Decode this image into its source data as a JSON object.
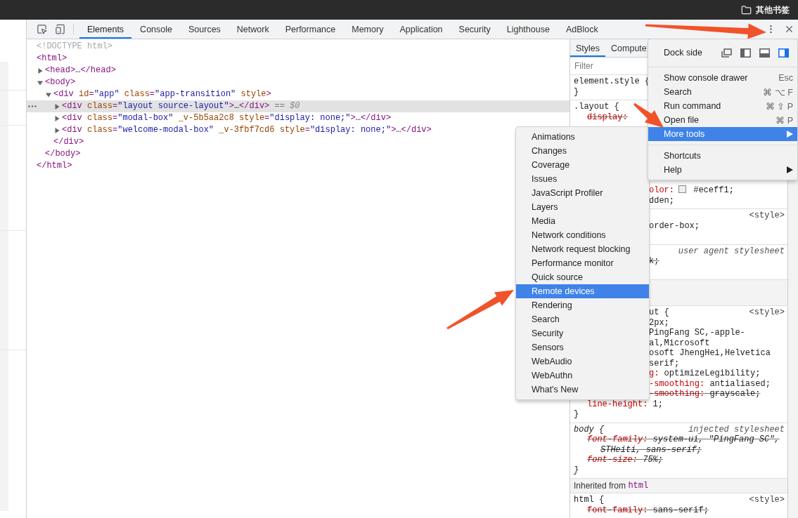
{
  "bookmarks_bar": {
    "folder": "其他书签"
  },
  "toolbar": {
    "tabs": [
      {
        "label": "Elements",
        "selected": true
      },
      {
        "label": "Console",
        "selected": false
      },
      {
        "label": "Sources",
        "selected": false
      },
      {
        "label": "Network",
        "selected": false
      },
      {
        "label": "Performance",
        "selected": false
      },
      {
        "label": "Memory",
        "selected": false
      },
      {
        "label": "Application",
        "selected": false
      },
      {
        "label": "Security",
        "selected": false
      },
      {
        "label": "Lighthouse",
        "selected": false
      },
      {
        "label": "AdBlock",
        "selected": false
      }
    ]
  },
  "dom_tree": [
    {
      "selected": false,
      "tokens": [
        {
          "kind": "doctype",
          "text": "<!DOCTYPE html>"
        }
      ]
    },
    {
      "selected": false,
      "tokens": [
        {
          "kind": "tag",
          "text": "<html>"
        }
      ],
      "closing": [
        {
          "kind": "tag",
          "text": "</html>"
        }
      ],
      "children": [
        {
          "selected": false,
          "expanded": false,
          "tokens": [
            {
              "kind": "tag",
              "text": "<head>"
            },
            {
              "kind": "text",
              "text": "…"
            },
            {
              "kind": "tag",
              "text": "</head>"
            }
          ]
        },
        {
          "selected": false,
          "expanded": true,
          "tokens": [
            {
              "kind": "tag",
              "text": "<body>"
            }
          ],
          "closing": [
            {
              "kind": "tag",
              "text": "</body>"
            }
          ],
          "children": [
            {
              "selected": false,
              "expanded": true,
              "tokens": [
                {
                  "kind": "tag",
                  "text": "<div"
                },
                {
                  "kind": "attr",
                  "text": " id"
                },
                {
                  "kind": "tag",
                  "text": "="
                },
                {
                  "kind": "value",
                  "text": "\"app\""
                },
                {
                  "kind": "attr",
                  "text": " class"
                },
                {
                  "kind": "tag",
                  "text": "="
                },
                {
                  "kind": "value",
                  "text": "\"app-transition\""
                },
                {
                  "kind": "attr",
                  "text": " style"
                },
                {
                  "kind": "tag",
                  "text": ">"
                }
              ],
              "closing": [
                {
                  "kind": "tag",
                  "text": "</div>"
                }
              ],
              "children": [
                {
                  "selected": true,
                  "expanded": false,
                  "tokens": [
                    {
                      "kind": "tag",
                      "text": "<div"
                    },
                    {
                      "kind": "attr",
                      "text": " class"
                    },
                    {
                      "kind": "tag",
                      "text": "="
                    },
                    {
                      "kind": "value",
                      "text": "\"layout source-layout\""
                    },
                    {
                      "kind": "tag",
                      "text": ">"
                    },
                    {
                      "kind": "text",
                      "text": "…"
                    },
                    {
                      "kind": "tag",
                      "text": "</div>"
                    },
                    {
                      "kind": "hint",
                      "text": " == "
                    },
                    {
                      "kind": "var",
                      "text": "$0"
                    }
                  ]
                },
                {
                  "selected": false,
                  "expanded": false,
                  "tokens": [
                    {
                      "kind": "tag",
                      "text": "<div"
                    },
                    {
                      "kind": "attr",
                      "text": " class"
                    },
                    {
                      "kind": "tag",
                      "text": "="
                    },
                    {
                      "kind": "value",
                      "text": "\"modal-box\""
                    },
                    {
                      "kind": "attr",
                      "text": " _v-5b5aa2c8"
                    },
                    {
                      "kind": "attr",
                      "text": " style"
                    },
                    {
                      "kind": "tag",
                      "text": "="
                    },
                    {
                      "kind": "value",
                      "text": "\"display: none;\""
                    },
                    {
                      "kind": "tag",
                      "text": ">"
                    },
                    {
                      "kind": "text",
                      "text": "…"
                    },
                    {
                      "kind": "tag",
                      "text": "</div>"
                    }
                  ]
                },
                {
                  "selected": false,
                  "expanded": false,
                  "tokens": [
                    {
                      "kind": "tag",
                      "text": "<div"
                    },
                    {
                      "kind": "attr",
                      "text": " class"
                    },
                    {
                      "kind": "tag",
                      "text": "="
                    },
                    {
                      "kind": "value",
                      "text": "\"welcome-modal-box\""
                    },
                    {
                      "kind": "attr",
                      "text": " _v-3fbf7cd6"
                    },
                    {
                      "kind": "attr",
                      "text": " style"
                    },
                    {
                      "kind": "tag",
                      "text": "="
                    },
                    {
                      "kind": "value",
                      "text": "\"display: none;\""
                    },
                    {
                      "kind": "tag",
                      "text": ">"
                    },
                    {
                      "kind": "text",
                      "text": "…"
                    },
                    {
                      "kind": "tag",
                      "text": "</div>"
                    }
                  ]
                }
              ]
            }
          ]
        }
      ]
    }
  ],
  "styles": {
    "tabs": [
      {
        "label": "Styles",
        "selected": true
      },
      {
        "label": "Compute",
        "selected": false
      }
    ],
    "filter": {
      "placeholder": "Filter"
    },
    "sections": [
      {
        "kind": "rule",
        "italic": false,
        "close": "}",
        "lines": [
          {
            "kind": "selector",
            "text": "element.style {"
          }
        ]
      },
      {
        "kind": "rule",
        "italic": false,
        "lines": [
          {
            "kind": "selector",
            "text": ".layout {"
          },
          {
            "kind": "decl",
            "prop": "display:",
            "struck": true
          },
          {
            "kind": "decl",
            "prop": "olor:",
            "color": "#eceff1",
            "value": " #eceff1;",
            "covered": true,
            "struck": false,
            "gap_before": true
          },
          {
            "kind": "decl",
            "value": "dden;",
            "covered": true,
            "struck": false
          }
        ]
      },
      {
        "kind": "rule",
        "italic": false,
        "source": {
          "text": "<style>",
          "kind": "link"
        },
        "lines": [
          {
            "kind": "decl",
            "value": "order-box;",
            "covered": true,
            "struck": false
          }
        ]
      },
      {
        "kind": "rule",
        "italic": false,
        "source": {
          "text": "user agent stylesheet",
          "kind": "sheet"
        },
        "lines": [
          {
            "kind": "decl",
            "value": "k;",
            "covered": true,
            "struck": true
          }
        ]
      },
      {
        "kind": "inherited"
      },
      {
        "kind": "rule",
        "italic": false,
        "source": {
          "text": "<style>",
          "kind": "link"
        },
        "close": "}",
        "lines": [
          {
            "kind": "selector",
            "text": "ut {",
            "covered": true
          },
          {
            "kind": "decl",
            "value": "2px;",
            "covered": true,
            "struck": false
          },
          {
            "kind": "decl",
            "value": "PingFang SC,-apple-",
            "covered": true,
            "struck": false
          },
          {
            "kind": "decl",
            "value": "al,Microsoft",
            "covered": true,
            "struck": false
          },
          {
            "kind": "decl",
            "value": "osoft JhengHei,Helvetica",
            "covered": true,
            "struck": false
          },
          {
            "kind": "decl",
            "value": "serif;",
            "covered": true,
            "struck": false
          },
          {
            "kind": "decl",
            "prop": "g:",
            "value": " optimizeLegibility;",
            "covered": true,
            "struck": false
          },
          {
            "kind": "decl",
            "prop": "-smoothing:",
            "value": " antialiased;",
            "covered": true,
            "struck": false
          },
          {
            "kind": "decl",
            "prop": "-smoothing:",
            "value": " grayscale;",
            "covered": true,
            "struck": true
          },
          {
            "kind": "decl",
            "prop": "line-height:",
            "value": " 1;",
            "struck": false
          }
        ]
      },
      {
        "kind": "rule",
        "italic": true,
        "source": {
          "text": "injected stylesheet",
          "kind": "sheet"
        },
        "close": "}",
        "lines": [
          {
            "kind": "selector",
            "text": "body {"
          },
          {
            "kind": "decl",
            "prop": "font-family:",
            "value": " system-ui, \"PingFang SC\",",
            "struck": true
          },
          {
            "kind": "wrap",
            "value": "STHeiti, sans-serif;",
            "struck": true
          },
          {
            "kind": "decl",
            "prop": "font-size:",
            "value": " 75%;",
            "struck": true
          }
        ]
      },
      {
        "kind": "inherited",
        "label": "Inherited from",
        "element": "html"
      },
      {
        "kind": "rule",
        "italic": false,
        "source": {
          "text": "<style>",
          "kind": "link"
        },
        "lines": [
          {
            "kind": "selector",
            "text": "html {"
          },
          {
            "kind": "decl",
            "prop": "font-family:",
            "value": " sans-serif;",
            "struck": true
          }
        ]
      }
    ]
  },
  "main_menu": [
    {
      "kind": "dock",
      "label": "Dock side",
      "options": [
        {
          "kind": "undock",
          "selected": false
        },
        {
          "kind": "left",
          "selected": false
        },
        {
          "kind": "bottom",
          "selected": false
        },
        {
          "kind": "right",
          "selected": true
        }
      ]
    },
    {
      "kind": "separator"
    },
    {
      "kind": "item",
      "label": "Show console drawer",
      "shortcut": "Esc",
      "selected": false,
      "has_submenu": false
    },
    {
      "kind": "item",
      "label": "Search",
      "shortcut": "⌘ ⌥ F",
      "selected": false,
      "has_submenu": false
    },
    {
      "kind": "item",
      "label": "Run command",
      "shortcut": "⌘ ⇧ P",
      "selected": false,
      "has_submenu": false
    },
    {
      "kind": "item",
      "label": "Open file",
      "shortcut": "⌘ P",
      "selected": false,
      "has_submenu": false
    },
    {
      "kind": "item",
      "label": "More tools",
      "selected": true,
      "has_submenu": true
    },
    {
      "kind": "separator"
    },
    {
      "kind": "item",
      "label": "Shortcuts",
      "selected": false,
      "has_submenu": false
    },
    {
      "kind": "item",
      "label": "Help",
      "selected": false,
      "has_submenu": true
    }
  ],
  "more_tools_menu": [
    {
      "label": "Animations",
      "selected": false
    },
    {
      "label": "Changes",
      "selected": false
    },
    {
      "label": "Coverage",
      "selected": false
    },
    {
      "label": "Issues",
      "selected": false
    },
    {
      "label": "JavaScript Profiler",
      "selected": false
    },
    {
      "label": "Layers",
      "selected": false
    },
    {
      "label": "Media",
      "selected": false
    },
    {
      "label": "Network conditions",
      "selected": false
    },
    {
      "label": "Network request blocking",
      "selected": false
    },
    {
      "label": "Performance monitor",
      "selected": false
    },
    {
      "label": "Quick source",
      "selected": false
    },
    {
      "label": "Remote devices",
      "selected": true
    },
    {
      "label": "Rendering",
      "selected": false
    },
    {
      "label": "Search",
      "selected": false
    },
    {
      "label": "Security",
      "selected": false
    },
    {
      "label": "Sensors",
      "selected": false
    },
    {
      "label": "WebAudio",
      "selected": false
    },
    {
      "label": "WebAuthn",
      "selected": false
    },
    {
      "label": "What's New",
      "selected": false
    }
  ]
}
